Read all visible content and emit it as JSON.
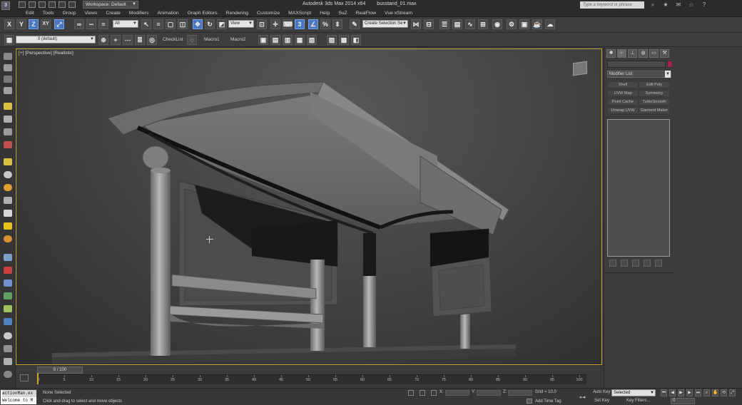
{
  "titlebar": {
    "logo": "3",
    "workspace": "Workspace: Default",
    "app_title": "Autodesk 3ds Max 2014 x64",
    "file_name": "busstand_01.max",
    "search_placeholder": "Type a keyword or phrase"
  },
  "menu": [
    "Edit",
    "Tools",
    "Group",
    "Views",
    "Create",
    "Modifiers",
    "Animation",
    "Graph Editors",
    "Rendering",
    "Customize",
    "MAXScript",
    "Help",
    "SuZ",
    "RealFlow",
    "Vue xStream"
  ],
  "toolbar": {
    "axis_x": "X",
    "axis_y": "Y",
    "axis_z": "Z",
    "axis_xy": "XY",
    "selection_filter": "All",
    "ref_coord": "View",
    "named_selection": "Create Selection Se",
    "layer": "0 (default)",
    "checklist": "CheckList",
    "macro1": "Macro1",
    "macro2": "Macro2"
  },
  "viewport": {
    "label": "[+] [Perspective] [Realistic]"
  },
  "command_panel": {
    "modifier_list": "Modifier List",
    "buttons": [
      "Shell",
      "Edit Poly",
      "UVW Map",
      "Symmetry",
      "Point Cache",
      "TurboSmooth",
      "Unwrap UVW",
      "Garment Maker"
    ]
  },
  "timeline": {
    "frame": "0 / 100",
    "ticks": [
      "0",
      "5",
      "10",
      "15",
      "20",
      "25",
      "30",
      "35",
      "40",
      "45",
      "50",
      "55",
      "60",
      "65",
      "70",
      "75",
      "80",
      "85",
      "90",
      "95",
      "100"
    ]
  },
  "status": {
    "listener_line1": "actionMan.ex",
    "listener_line2": "Welcome to M",
    "selection": "None Selected",
    "prompt": "Click and drag to select and move objects",
    "grid": "Grid = 10.0",
    "add_time_tag": "Add Time Tag",
    "auto_key": "Auto Key",
    "set_key": "Set Key",
    "key_mode": "Selected",
    "key_filters": "Key Filters...",
    "frame_field": "0"
  },
  "colors": {
    "viewport_border": "#c9a832",
    "object_color": "#a4224a",
    "active_button": "#4a78c0"
  }
}
